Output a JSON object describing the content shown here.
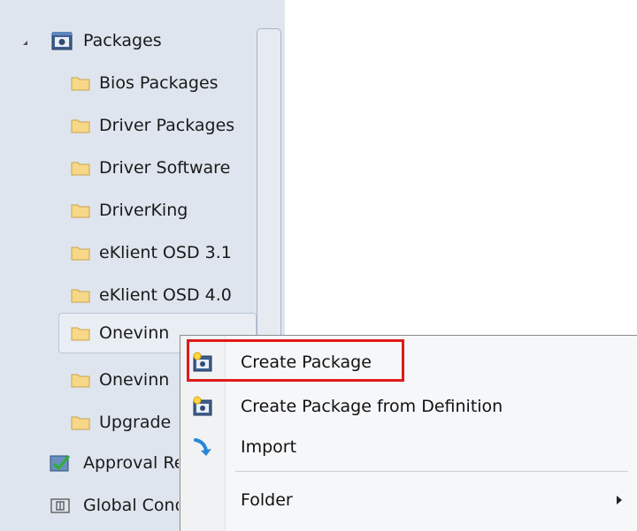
{
  "tree": {
    "root": {
      "label": "Packages",
      "icon": "package-icon",
      "expanded": true
    },
    "folders": [
      {
        "label": "Bios Packages",
        "icon": "folder-icon"
      },
      {
        "label": "Driver Packages",
        "icon": "folder-icon"
      },
      {
        "label": "Driver Software",
        "icon": "folder-icon"
      },
      {
        "label": "DriverKing",
        "icon": "folder-icon"
      },
      {
        "label": "eKlient OSD 3.1",
        "icon": "folder-icon"
      },
      {
        "label": "eKlient OSD 4.0",
        "icon": "folder-icon"
      },
      {
        "label": "Onevinn",
        "icon": "folder-icon",
        "selected": true
      },
      {
        "label": "Onevinn",
        "icon": "folder-icon"
      },
      {
        "label": "Upgrade",
        "icon": "folder-icon"
      }
    ],
    "siblings": [
      {
        "label": "Approval Requests",
        "icon": "approval-icon"
      },
      {
        "label": "Global Conditions",
        "icon": "global-conditions-icon"
      }
    ]
  },
  "context_menu": {
    "items": [
      {
        "label": "Create Package",
        "icon": "create-package-icon",
        "highlighted": true
      },
      {
        "label": "Create Package from Definition",
        "icon": "create-package-definition-icon"
      },
      {
        "label": "Import",
        "icon": "import-arrow-icon"
      },
      {
        "label": "Folder",
        "icon": "",
        "has_submenu": true
      }
    ]
  },
  "colors": {
    "tree_background": "#dfe5ee",
    "highlight_border": "#e01a1a",
    "folder_fill": "#f7d889"
  }
}
